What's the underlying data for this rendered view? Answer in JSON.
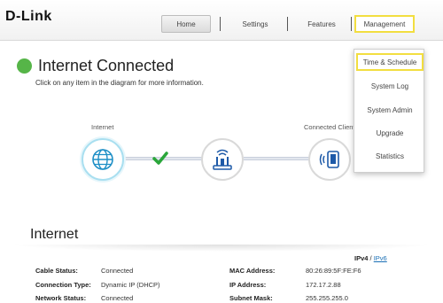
{
  "brand": {
    "logo_text": "D-Link"
  },
  "nav": {
    "home": "Home",
    "settings": "Settings",
    "features": "Features",
    "management": "Management"
  },
  "status": {
    "title": "Internet Connected",
    "subtitle": "Click on any item in the diagram for more information.",
    "status_color": "#56b548"
  },
  "diagram": {
    "internet_label": "Internet",
    "clients_label": "Connected Clients",
    "check_color": "#2aa63a",
    "icons": [
      "globe-icon",
      "router-icon",
      "client-device-icon"
    ]
  },
  "management_menu": {
    "items": [
      "Time & Schedule",
      "System Log",
      "System Admin",
      "Upgrade",
      "Statistics"
    ],
    "highlight_color": "#f2de40"
  },
  "internet_section": {
    "title": "Internet",
    "ipv4": "IPv4",
    "separator": "/",
    "ipv6": "IPv6",
    "fields": {
      "cable_status_label": "Cable Status:",
      "cable_status": "Connected",
      "connection_type_label": "Connection Type:",
      "connection_type": "Dynamic IP (DHCP)",
      "network_status_label": "Network Status:",
      "network_status": "Connected",
      "mac_label": "MAC Address:",
      "mac": "80:26:89:5F:FE:F6",
      "ip_label": "IP Address:",
      "ip": "172.17.2.88",
      "subnet_label": "Subnet Mask:",
      "subnet": "255.255.255.0"
    }
  }
}
